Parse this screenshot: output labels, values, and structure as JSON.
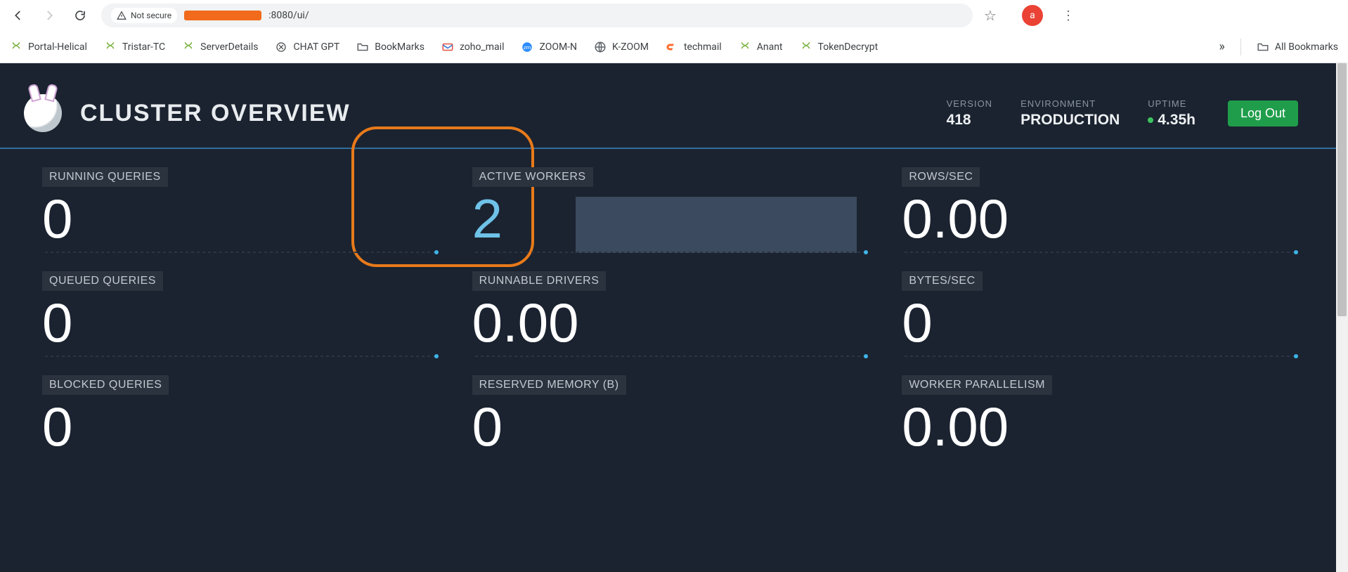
{
  "browser": {
    "security_label": "Not secure",
    "url_suffix": ":8080/ui/",
    "profile_letter": "a",
    "bookmarks": [
      "Portal-Helical",
      "Tristar-TC",
      "ServerDetails",
      "CHAT GPT",
      "BookMarks",
      "zoho_mail",
      "ZOOM-N",
      "K-ZOOM",
      "techmail",
      "Anant",
      "TokenDecrypt"
    ],
    "all_bookmarks_label": "All Bookmarks"
  },
  "header": {
    "title": "CLUSTER OVERVIEW",
    "version_label": "VERSION",
    "version_value": "418",
    "env_label": "ENVIRONMENT",
    "env_value": "PRODUCTION",
    "uptime_label": "UPTIME",
    "uptime_value": "4.35h",
    "logout_label": "Log Out"
  },
  "cards": {
    "running_queries": {
      "label": "RUNNING QUERIES",
      "value": "0"
    },
    "active_workers": {
      "label": "ACTIVE WORKERS",
      "value": "2"
    },
    "rows_sec": {
      "label": "ROWS/SEC",
      "value": "0.00"
    },
    "queued_queries": {
      "label": "QUEUED QUERIES",
      "value": "0"
    },
    "runnable_drivers": {
      "label": "RUNNABLE DRIVERS",
      "value": "0.00"
    },
    "bytes_sec": {
      "label": "BYTES/SEC",
      "value": "0"
    },
    "blocked_queries": {
      "label": "BLOCKED QUERIES",
      "value": "0"
    },
    "reserved_mem": {
      "label": "RESERVED MEMORY (B)",
      "value": "0"
    },
    "worker_para": {
      "label": "WORKER PARALLELISM",
      "value": "0.00"
    }
  }
}
